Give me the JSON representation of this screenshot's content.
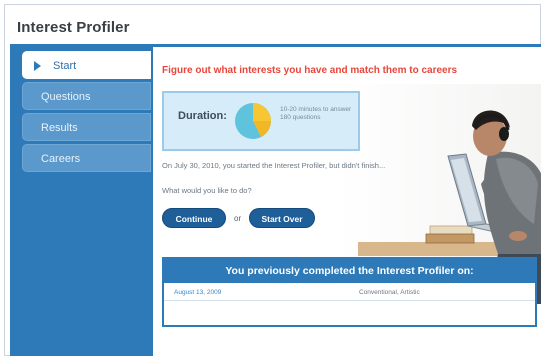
{
  "app": {
    "title": "Interest Profiler"
  },
  "sidebar": {
    "items": [
      {
        "label": "Start",
        "active": true
      },
      {
        "label": "Questions",
        "active": false
      },
      {
        "label": "Results",
        "active": false
      },
      {
        "label": "Careers",
        "active": false
      }
    ]
  },
  "main": {
    "headline": "Figure out what interests you have and match them to careers",
    "duration": {
      "label": "Duration:",
      "text": "10-20 minutes to answer 180 questions",
      "icon": "pie-chart-icon"
    },
    "status_text": "On July 30, 2010, you started the Interest Profiler, but didn't finish...",
    "question": "What would you like to do?",
    "continue_label": "Continue",
    "or_label": "or",
    "start_over_label": "Start Over"
  },
  "previous": {
    "header": "You previously completed the Interest Profiler on:",
    "rows": [
      {
        "date": "August 13, 2009",
        "codes": "Conventional, Artistic"
      }
    ]
  },
  "colors": {
    "brand_blue": "#2e7ab8",
    "headline_red": "#e8463a",
    "button_blue": "#1e5e99"
  }
}
